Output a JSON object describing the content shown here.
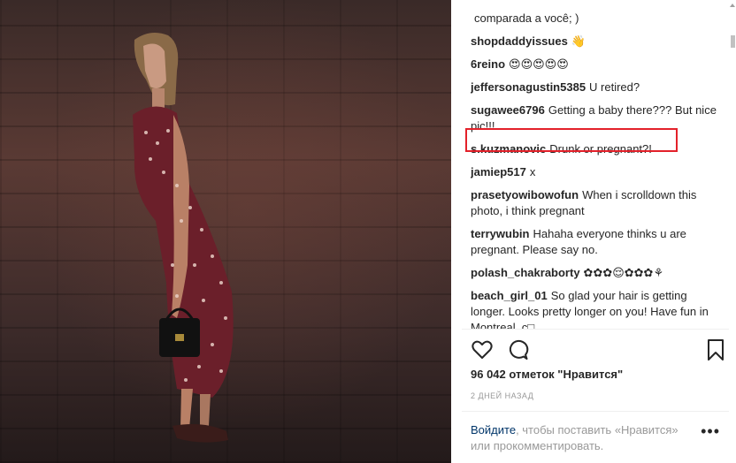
{
  "comments": [
    {
      "user": "",
      "text": "comparada a você; )"
    },
    {
      "user": "shopdaddyissues",
      "text": "👋"
    },
    {
      "user": "6reino",
      "text": "😍😍😍😍😍"
    },
    {
      "user": "jeffersonagustin5385",
      "text": "U retired?"
    },
    {
      "user": "sugawee6796",
      "text": "Getting a baby there??? But nice pic!!!"
    },
    {
      "user": "s.kuzmanovic",
      "text": "Drunk or pregnant?!"
    },
    {
      "user": "jamiep517",
      "text": "x"
    },
    {
      "user": "prasetyowibowofun",
      "text": "When i scrolldown this photo, i think pregnant"
    },
    {
      "user": "terrywubin",
      "text": "Hahaha everyone thinks u are pregnant. Please say no."
    },
    {
      "user": "polash_chakraborty",
      "text": "✿✿✿😌✿✿✿⚘"
    },
    {
      "user": "beach_girl_01",
      "text": "So glad your hair is getting longer. Looks pretty longer on you! Have fun in Montreal. c□"
    }
  ],
  "likes": "96 042 отметок \"Нравится\"",
  "date": "2 ДНЕЙ НАЗАД",
  "login": {
    "link": "Войдите",
    "rest": ", чтобы поставить «Нравится» или прокомментировать."
  },
  "more_label": "•••",
  "colors": {
    "highlight": "#e3212a",
    "link": "#003569",
    "muted": "#999999"
  }
}
